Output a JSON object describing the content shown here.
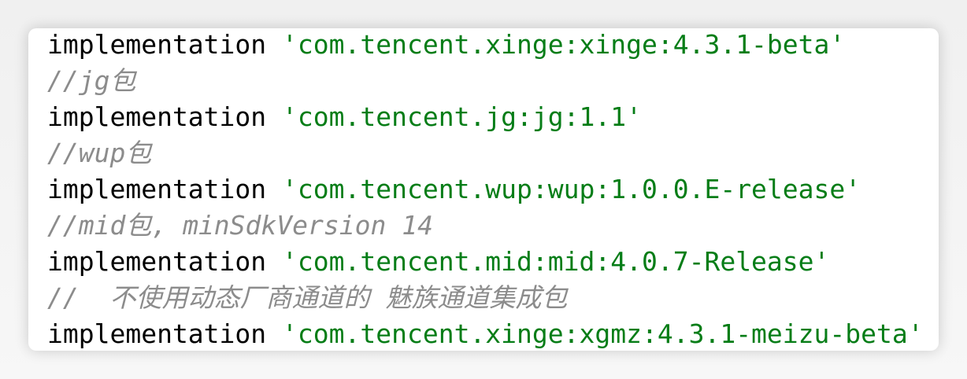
{
  "lines": [
    {
      "type": "code",
      "keyword": "implementation",
      "string": "'com.tencent.xinge:xinge:4.3.1-beta'"
    },
    {
      "type": "comment",
      "text": "//jg包"
    },
    {
      "type": "code",
      "keyword": "implementation",
      "string": "'com.tencent.jg:jg:1.1'"
    },
    {
      "type": "comment",
      "text": "//wup包"
    },
    {
      "type": "code",
      "keyword": "implementation",
      "string": "'com.tencent.wup:wup:1.0.0.E-release'"
    },
    {
      "type": "comment",
      "text": "//mid包, minSdkVersion 14"
    },
    {
      "type": "code",
      "keyword": "implementation",
      "string": "'com.tencent.mid:mid:4.0.7-Release'"
    },
    {
      "type": "comment",
      "text": "//  不使用动态厂商通道的 魅族通道集成包"
    },
    {
      "type": "code",
      "keyword": "implementation",
      "string": "'com.tencent.xinge:xgmz:4.3.1-meizu-beta'"
    }
  ],
  "colors": {
    "keyword": "#000000",
    "string": "#067d17",
    "comment": "#8c8c8c"
  }
}
